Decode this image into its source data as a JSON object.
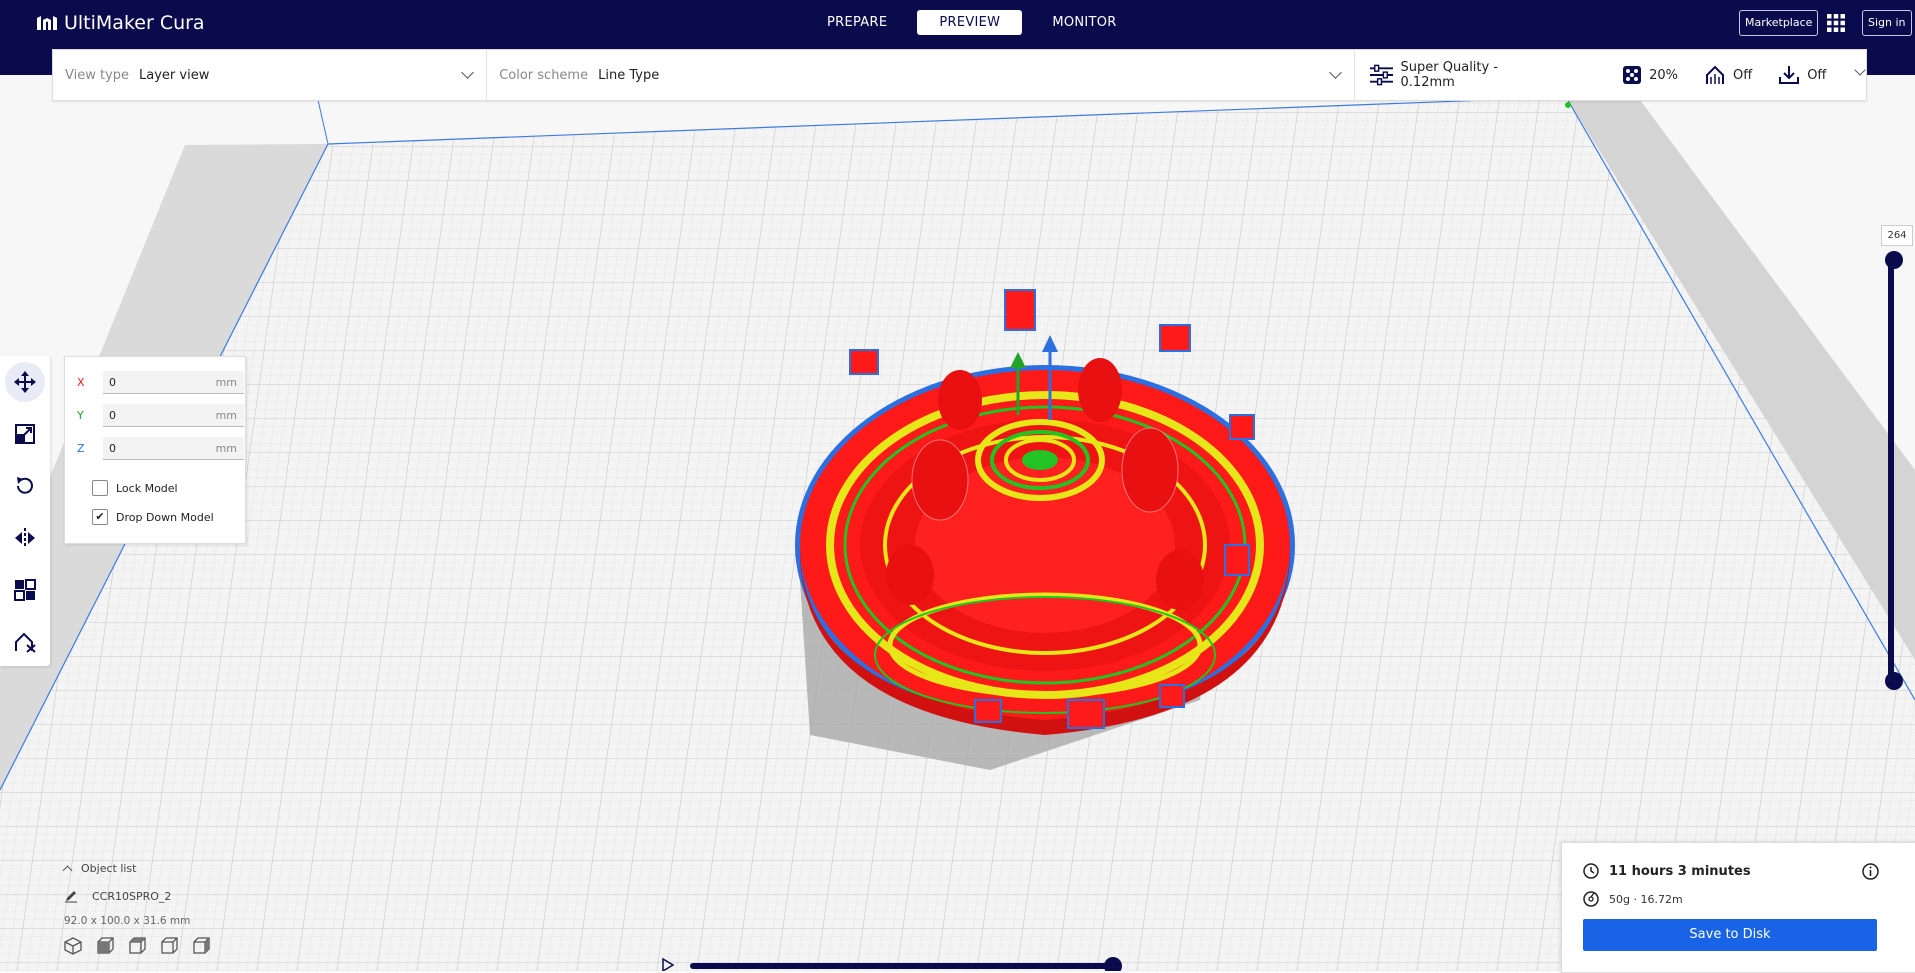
{
  "app": {
    "name": "UltiMaker Cura"
  },
  "stages": [
    {
      "label": "PREPARE",
      "active": false
    },
    {
      "label": "PREVIEW",
      "active": true
    },
    {
      "label": "MONITOR",
      "active": false
    }
  ],
  "header": {
    "marketplace_label": "Marketplace",
    "signin_label": "Sign in"
  },
  "viewbar": {
    "view_type_label": "View type",
    "view_type_value": "Layer view",
    "color_scheme_label": "Color scheme",
    "color_scheme_value": "Line Type"
  },
  "print_settings": {
    "profile": "Super Quality - 0.12mm",
    "infill": "20%",
    "support": "Off",
    "adhesion": "Off"
  },
  "move_panel": {
    "x": {
      "axis": "X",
      "value": "0",
      "unit": "mm"
    },
    "y": {
      "axis": "Y",
      "value": "0",
      "unit": "mm"
    },
    "z": {
      "axis": "Z",
      "value": "0",
      "unit": "mm"
    },
    "lock_model": {
      "label": "Lock Model",
      "checked": false
    },
    "drop_down_model": {
      "label": "Drop Down Model",
      "checked": true
    }
  },
  "object_list": {
    "header": "Object list",
    "object_name": "CCR10SPRO_2",
    "dimensions": "92.0 x 100.0 x 31.6 mm"
  },
  "layer_slider": {
    "current_layer": "264"
  },
  "print_info": {
    "time": "11 hours 3 minutes",
    "material": "50g · 16.72m",
    "save_label": "Save to Disk"
  },
  "colors": {
    "header_bg": "#0a0b4d",
    "accent": "#1963e6",
    "model_red": "#ff1a1a",
    "model_yellow": "#e6e619",
    "model_green": "#22c322",
    "outline_blue": "#2b6fe0"
  }
}
